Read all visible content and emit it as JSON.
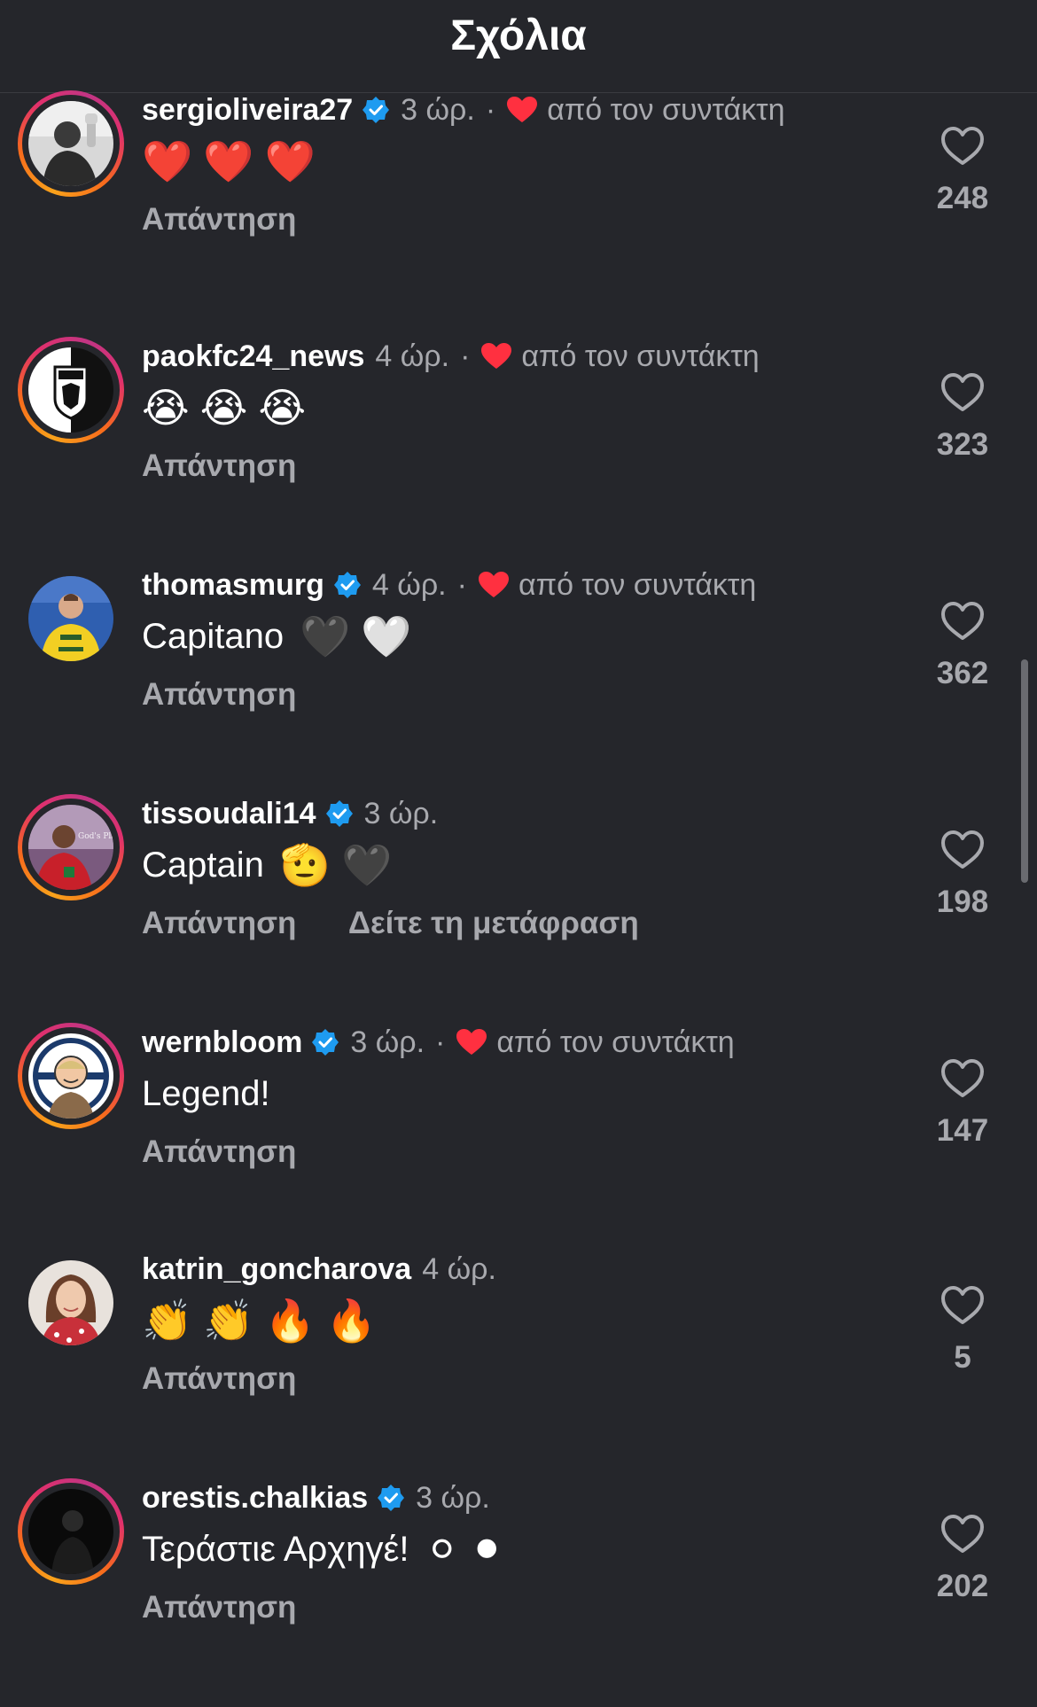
{
  "header": {
    "title": "Σχόλια"
  },
  "common": {
    "reply_label": "Απάντηση",
    "author_like_text": "από τον συντάκτη"
  },
  "colors": {
    "background": "#25262b",
    "muted_text": "#a8a9ae",
    "verified_blue": "#1e9bf0",
    "heart_red": "#ff3040"
  },
  "comments": [
    {
      "username": "sergioliveira27",
      "verified": true,
      "time": "3 ώρ.",
      "liked_by_author": true,
      "text": "",
      "emojis": [
        "❤️",
        "❤️",
        "❤️"
      ],
      "extra_action": "",
      "likes": "248",
      "avatar": "person-waving-avatar"
    },
    {
      "username": "paokfc24_news",
      "verified": false,
      "time": "4 ώρ.",
      "liked_by_author": true,
      "text": "",
      "emojis": [
        "😭",
        "😭",
        "😭"
      ],
      "extra_action": "",
      "likes": "323",
      "avatar": "paok-logo-avatar"
    },
    {
      "username": "thomasmurg",
      "verified": true,
      "time": "4 ώρ.",
      "liked_by_author": true,
      "text": "Capitano",
      "emojis": [
        "🖤",
        "🤍"
      ],
      "extra_action": "",
      "likes": "362",
      "avatar": "player-yellow-kit-avatar"
    },
    {
      "username": "tissoudali14",
      "verified": true,
      "time": "3 ώρ.",
      "liked_by_author": false,
      "text": "Captain",
      "emojis": [
        "🫡",
        "🖤"
      ],
      "extra_action": "Δείτε τη μετάφραση",
      "likes": "198",
      "avatar": "player-red-kit-avatar",
      "avatar_caption": "God's Plan."
    },
    {
      "username": "wernbloom",
      "verified": true,
      "time": "3 ώρ.",
      "liked_by_author": true,
      "text": "Legend!",
      "emojis": [],
      "extra_action": "",
      "likes": "147",
      "avatar": "cartoon-face-avatar"
    },
    {
      "username": "katrin_goncharova",
      "verified": false,
      "time": "4 ώρ.",
      "liked_by_author": false,
      "text": "",
      "emojis": [
        "👏",
        "👏",
        "🔥",
        "🔥"
      ],
      "extra_action": "",
      "likes": "5",
      "avatar": "woman-portrait-avatar"
    },
    {
      "username": "orestis.chalkias",
      "verified": true,
      "time": "3 ώρ.",
      "liked_by_author": false,
      "text": "Τεράστιε Αρχηγέ!",
      "emojis": [
        "⚪",
        "⚫"
      ],
      "extra_action": "",
      "likes": "202",
      "avatar": "dark-silhouette-avatar"
    }
  ]
}
